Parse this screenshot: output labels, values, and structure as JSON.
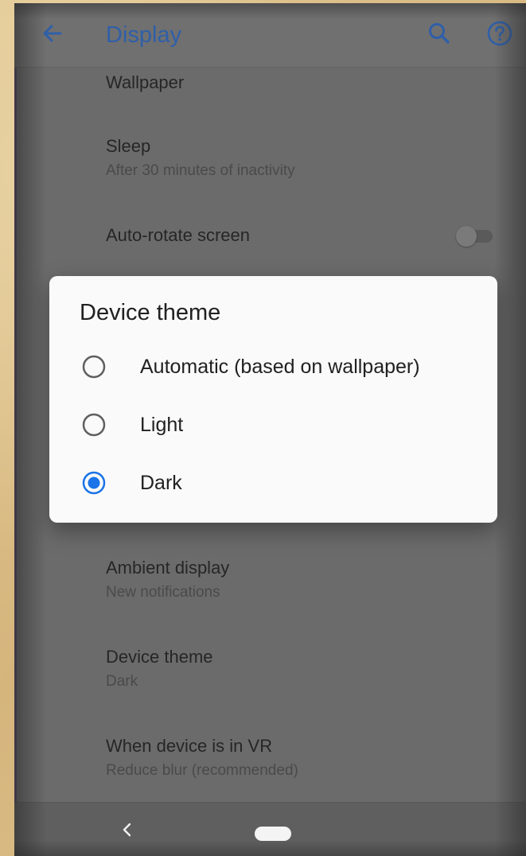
{
  "app_bar": {
    "title": "Display",
    "back_icon": "arrow-back-icon",
    "search_icon": "search-icon",
    "help_icon": "help-icon"
  },
  "settings": [
    {
      "title": "Wallpaper",
      "subtitle": ""
    },
    {
      "title": "Sleep",
      "subtitle": "After 30 minutes of inactivity"
    },
    {
      "title": "Auto-rotate screen",
      "subtitle": "",
      "toggle_on": false
    },
    {
      "title": "Ambient display",
      "subtitle": "New notifications"
    },
    {
      "title": "Device theme",
      "subtitle": "Dark"
    },
    {
      "title": "When device is in VR",
      "subtitle": "Reduce blur (recommended)"
    }
  ],
  "dialog": {
    "title": "Device theme",
    "options": [
      {
        "label": "Automatic (based on wallpaper)",
        "selected": false
      },
      {
        "label": "Light",
        "selected": false
      },
      {
        "label": "Dark",
        "selected": true
      }
    ]
  },
  "nav": {
    "back_icon": "nav-back-icon",
    "home_icon": "home-pill-icon"
  },
  "colors": {
    "accent": "#1a73e8",
    "scrim_bg": "#6b6b6b",
    "dialog_bg": "#fafafa"
  }
}
